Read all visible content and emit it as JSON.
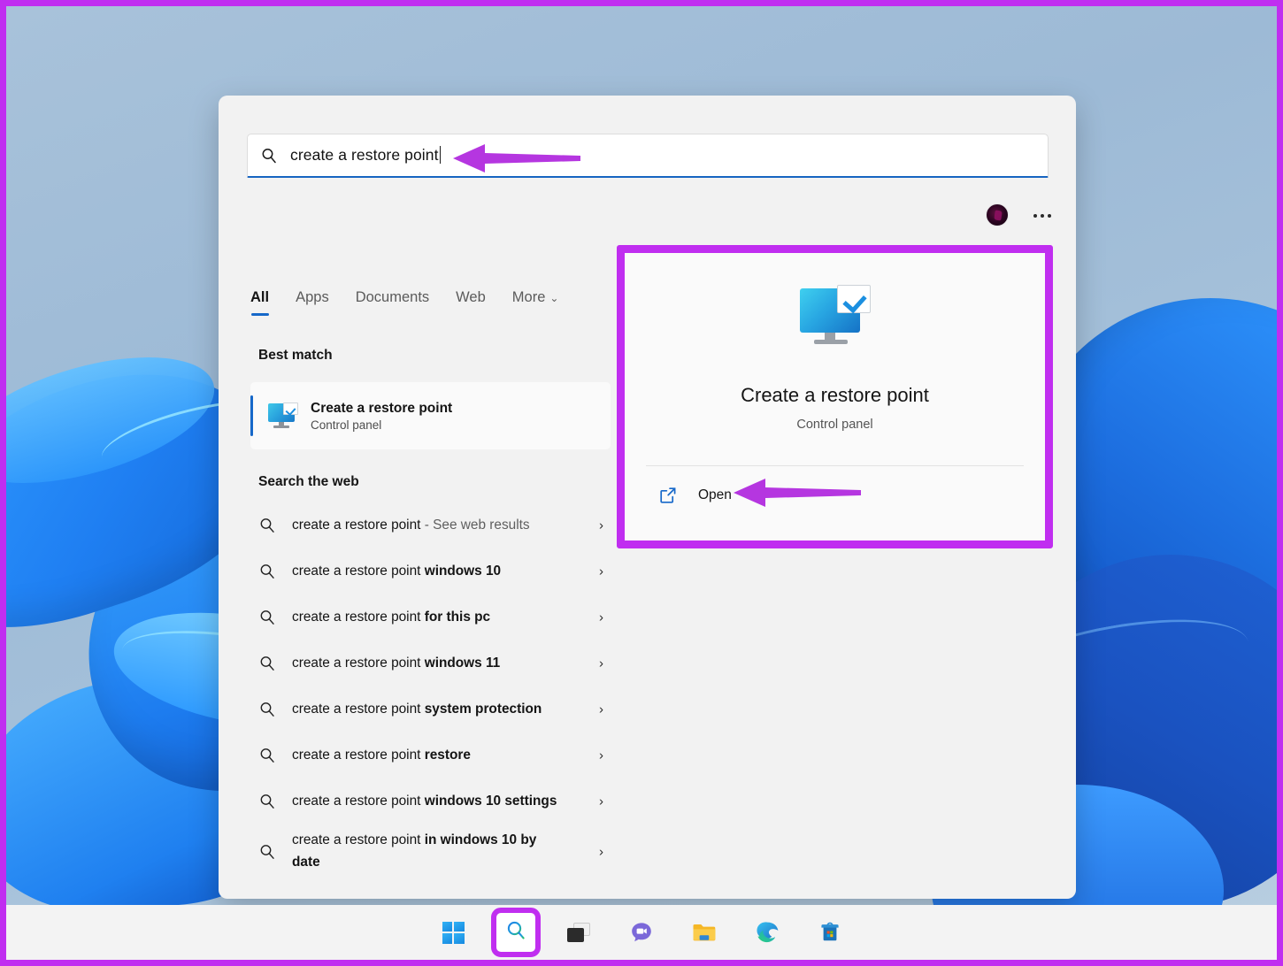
{
  "search": {
    "query": "create a restore point",
    "icon": "search-icon"
  },
  "tabs": [
    {
      "label": "All",
      "active": true
    },
    {
      "label": "Apps",
      "active": false
    },
    {
      "label": "Documents",
      "active": false
    },
    {
      "label": "Web",
      "active": false
    },
    {
      "label": "More",
      "active": false,
      "chevron": "⌄"
    }
  ],
  "headers": {
    "best_match": "Best match",
    "search_the_web": "Search the web"
  },
  "best_match": {
    "title": "Create a restore point",
    "subtitle": "Control panel",
    "icon": "monitor-check-icon"
  },
  "suggestions": [
    {
      "prefix": "create a restore point",
      "suffix": " - See web results",
      "suffix_style": "dim"
    },
    {
      "prefix": "create a restore point ",
      "suffix": "windows 10",
      "suffix_style": "bold"
    },
    {
      "prefix": "create a restore point ",
      "suffix": "for this pc",
      "suffix_style": "bold"
    },
    {
      "prefix": "create a restore point ",
      "suffix": "windows 11",
      "suffix_style": "bold"
    },
    {
      "prefix": "create a restore point ",
      "suffix": "system protection",
      "suffix_style": "bold"
    },
    {
      "prefix": "create a restore point ",
      "suffix": "restore",
      "suffix_style": "bold"
    },
    {
      "prefix": "create a restore point ",
      "suffix": "windows 10 settings",
      "suffix_style": "bold"
    },
    {
      "prefix": "create a restore point ",
      "suffix": "in windows 10 by date",
      "suffix_style": "bold"
    }
  ],
  "preview": {
    "title": "Create a restore point",
    "subtitle": "Control panel",
    "open_label": "Open",
    "open_icon": "external-link-icon",
    "app_icon": "monitor-check-icon"
  },
  "taskbar": [
    {
      "name": "start",
      "label": "Start"
    },
    {
      "name": "search",
      "label": "Search",
      "highlighted": true
    },
    {
      "name": "task-view",
      "label": "Task View"
    },
    {
      "name": "chat",
      "label": "Chat"
    },
    {
      "name": "file-explorer",
      "label": "File Explorer"
    },
    {
      "name": "edge",
      "label": "Microsoft Edge"
    },
    {
      "name": "store",
      "label": "Microsoft Store"
    }
  ],
  "annotations": {
    "highlight_color": "#c02ef0",
    "arrow_color": "#b536e0",
    "accent_blue": "#1668c9"
  }
}
